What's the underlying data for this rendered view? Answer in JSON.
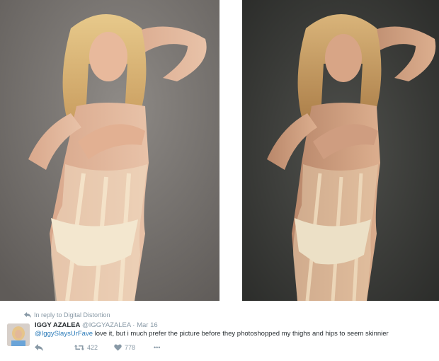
{
  "tweet": {
    "reply_context": "In reply to Digital Distortion",
    "author_name": "IGGY AZALEA",
    "author_handle": "@IGGYAZALEA",
    "separator": "·",
    "date": "Mar 16",
    "mention": "@IggySlaysUrFave",
    "text": " love it, but i much prefer the picture before they photoshopped my thighs and hips to seem skinnier",
    "retweet_count": "422",
    "like_count": "778",
    "more_label": "•••"
  },
  "icons": [
    "reply-icon",
    "retweet-icon",
    "like-icon",
    "more-icon"
  ],
  "colors": {
    "muted": "#8899a6",
    "link": "#2b7bb9",
    "text": "#292f33",
    "left_photo_bg": "#7d7772",
    "right_photo_bg": "#3b3c3a"
  }
}
